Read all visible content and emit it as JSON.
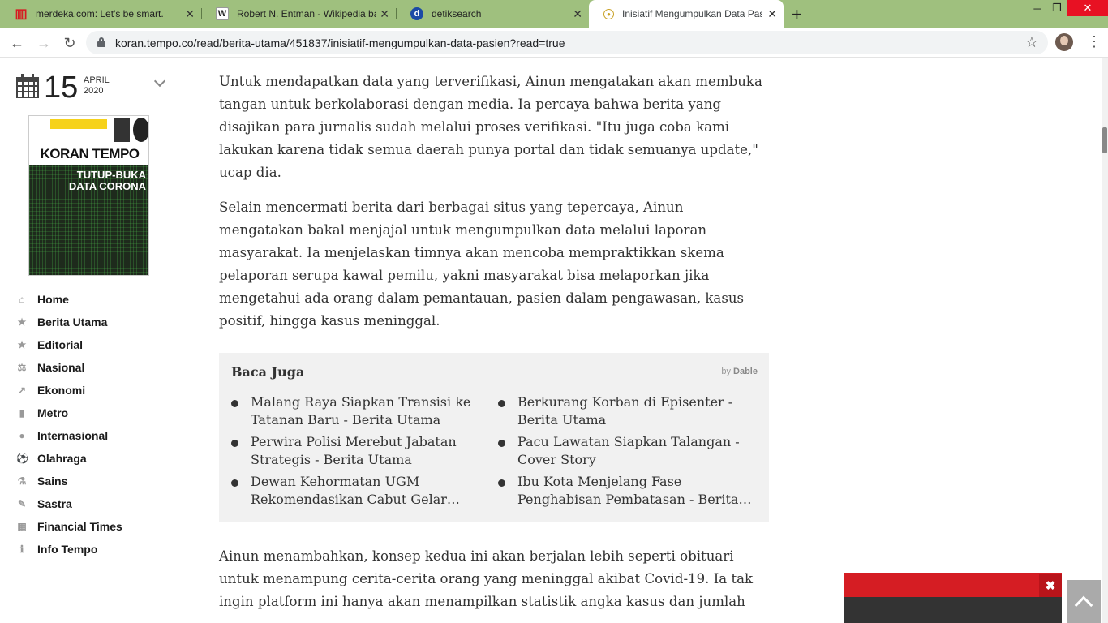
{
  "browser": {
    "tabs": [
      {
        "title": "merdeka.com: Let's be smart.",
        "icon": "merdeka-icon",
        "icon_color": "#d71920"
      },
      {
        "title": "Robert N. Entman - Wikipedia bahasa",
        "icon": "wikipedia-icon",
        "icon_color": "#333333"
      },
      {
        "title": "detiksearch",
        "icon": "detik-icon",
        "icon_color": "#1b4aa6"
      },
      {
        "title": "Inisiatif Mengumpulkan Data Pasien",
        "icon": "tempo-icon",
        "icon_color": "#c9a227"
      }
    ],
    "active_tab": 3,
    "url": "koran.tempo.co/read/berita-utama/451837/inisiatif-mengumpulkan-data-pasien?read=true",
    "chrome_color": "#9fc07e"
  },
  "sidebar": {
    "date_day": "15",
    "date_month": "APRIL",
    "date_year": "2020",
    "cover_masthead": "KORAN TEMPO",
    "cover_headline": "TUTUP-BUKA DATA CORONA",
    "menu": [
      {
        "label": "Home",
        "icon": "home-icon"
      },
      {
        "label": "Berita Utama",
        "icon": "star-icon"
      },
      {
        "label": "Editorial",
        "icon": "star-icon"
      },
      {
        "label": "Nasional",
        "icon": "scale-icon"
      },
      {
        "label": "Ekonomi",
        "icon": "chart-line-icon"
      },
      {
        "label": "Metro",
        "icon": "building-icon"
      },
      {
        "label": "Internasional",
        "icon": "globe-icon"
      },
      {
        "label": "Olahraga",
        "icon": "soccer-ball-icon"
      },
      {
        "label": "Sains",
        "icon": "flask-icon"
      },
      {
        "label": "Sastra",
        "icon": "pen-icon"
      },
      {
        "label": "Financial Times",
        "icon": "bar-chart-icon"
      },
      {
        "label": "Info Tempo",
        "icon": "info-icon"
      }
    ]
  },
  "article": {
    "paragraphs": [
      "Untuk mendapatkan data yang terverifikasi, Ainun mengatakan akan membuka tangan untuk berkolaborasi dengan media. Ia percaya bahwa berita yang disajikan para jurnalis sudah melalui proses verifikasi. \"Itu juga coba kami lakukan karena tidak semua daerah punya portal dan tidak semuanya update,\" ucap dia.",
      "Selain mencermati berita dari berbagai situs yang tepercaya, Ainun mengatakan bakal menjajal untuk mengumpulkan data melalui laporan masyarakat. Ia menjelaskan timnya akan mencoba mempraktikkan skema pelaporan serupa kawal pemilu, yakni masyarakat bisa melaporkan jika mengetahui ada orang dalam pemantauan, pasien dalam pengawasan, kasus positif, hingga kasus meninggal.",
      "Ainun menambahkan, konsep kedua ini akan berjalan lebih seperti obituari untuk menampung cerita-cerita orang yang meninggal akibat Covid-19. Ia tak ingin platform ini hanya akan menampilkan statistik angka kasus dan jumlah"
    ]
  },
  "baca_juga": {
    "title": "Baca Juga",
    "by": "by",
    "brand": "Dable",
    "items": [
      "Malang Raya Siapkan Transisi ke Tatanan Baru - Berita Utama",
      "Berkurang Korban di Episenter - Berita Utama",
      "Perwira Polisi Merebut Jabatan Strategis - Berita Utama",
      "Pacu Lawatan Siapkan Talangan - Cover Story",
      "Dewan Kehormatan UGM Rekomendasikan Cabut Gelar Rektor - Berita Utama",
      "Ibu Kota Menjelang Fase Penghabisan Pembatasan - Berita Utama"
    ]
  },
  "ad": {
    "close_label": "✖",
    "accent": "#d51d23"
  }
}
